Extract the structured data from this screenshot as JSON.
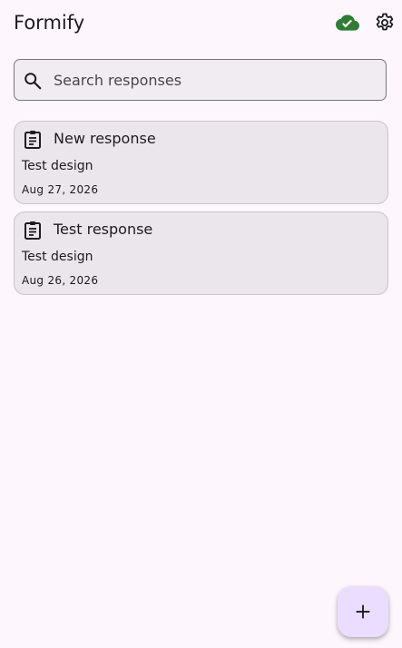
{
  "app": {
    "title": "Formify"
  },
  "header": {
    "sync_icon": "cloud-done-icon",
    "settings_icon": "gear-icon"
  },
  "search": {
    "placeholder": "Search responses",
    "value": ""
  },
  "responses": [
    {
      "title": "New response",
      "design": "Test design",
      "date": "Aug 27, 2026",
      "icon": "clipboard-icon"
    },
    {
      "title": "Test response",
      "design": "Test design",
      "date": "Aug 26, 2026",
      "icon": "clipboard-icon"
    }
  ],
  "fab": {
    "icon": "plus-icon"
  },
  "colors": {
    "background": "#fdf7fd",
    "card": "#ebe5ec",
    "sync_ok": "#2e7d32",
    "fab": "#ebddff"
  }
}
